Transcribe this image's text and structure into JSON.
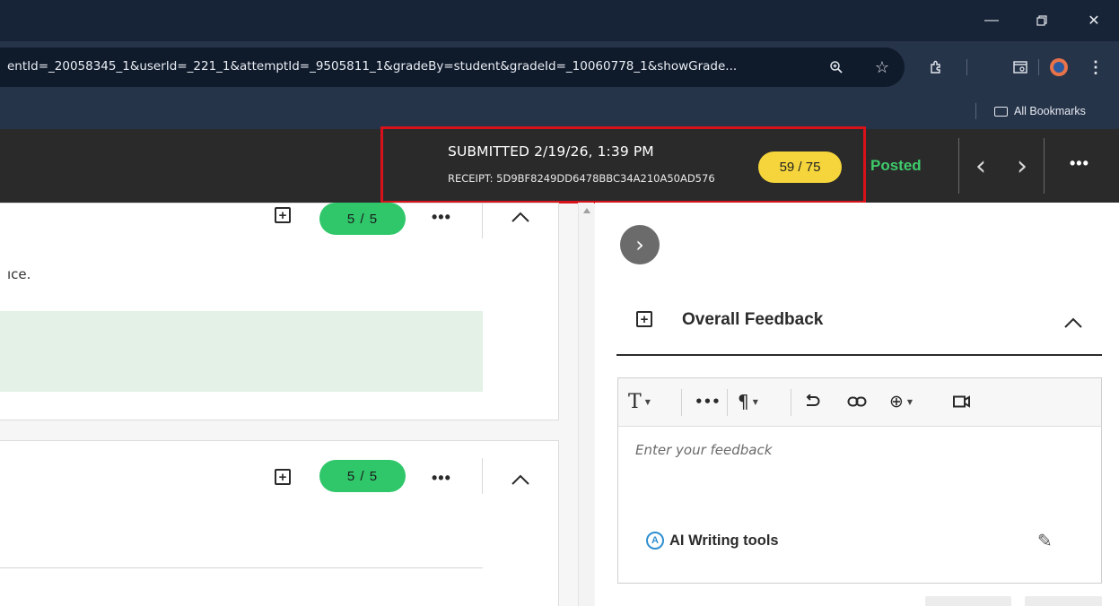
{
  "browser": {
    "url": "entId=_20058345_1&userId=_221_1&attemptId=_9505811_1&gradeBy=student&gradeId=_10060778_1&showGrade...",
    "bookmarks_label": "All Bookmarks",
    "icons": [
      "minimize-icon",
      "restore-icon",
      "close-icon",
      "zoom-icon",
      "star-icon",
      "extensions-icon",
      "reading-mode-icon",
      "profile-avatar",
      "kebab-menu-icon",
      "folder-icon"
    ]
  },
  "header": {
    "submitted": "SUBMITTED 2/19/26, 1:39 PM",
    "receipt": "RECEIPT: 5D9BF8249DD6478BBC34A210A50AD576",
    "score": "59 / 75",
    "status": "Posted",
    "more": "•••",
    "accent_color": "#d8121b",
    "score_color": "#f5d53b",
    "posted_color": "#3ecb6b"
  },
  "questions": [
    {
      "grade": "5 / 5",
      "more": "•••",
      "partial_text": "ıce."
    },
    {
      "grade": "5 / 5",
      "more": "•••"
    }
  ],
  "feedback": {
    "title": "Overall Feedback",
    "placeholder": "Enter your feedback",
    "ai_tools": "AI Writing tools",
    "toolbar": {
      "text_style": "T",
      "more": "•••",
      "paragraph": "¶",
      "undo": "⮌",
      "link": "⊖",
      "insert": "⊕",
      "video": "▭"
    }
  }
}
